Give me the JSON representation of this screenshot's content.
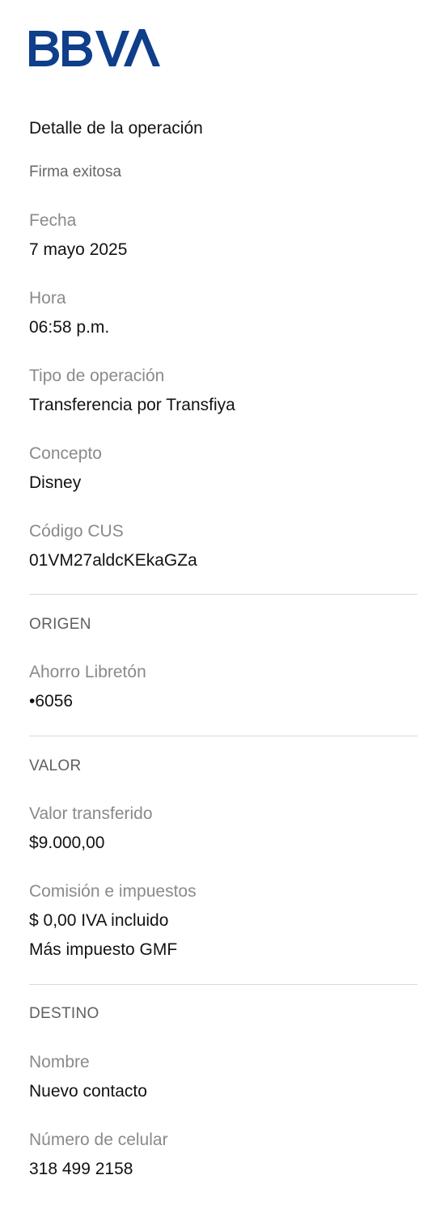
{
  "brand": {
    "name": "BBVA",
    "color": "#0f3e8a"
  },
  "header": {
    "title": "Detalle de la operación",
    "status": "Firma exitosa"
  },
  "details": {
    "fecha_label": "Fecha",
    "fecha_value": "7 mayo 2025",
    "hora_label": "Hora",
    "hora_value": "06:58 p.m.",
    "tipo_label": "Tipo de operación",
    "tipo_value": "Transferencia por Transfiya",
    "concepto_label": "Concepto",
    "concepto_value": "Disney",
    "cus_label": "Código CUS",
    "cus_value": "01VM27aldcKEkaGZa"
  },
  "origen": {
    "heading": "ORIGEN",
    "account_label": "Ahorro Libretón",
    "account_value": "•6056"
  },
  "valor": {
    "heading": "VALOR",
    "transferido_label": "Valor transferido",
    "transferido_value": "$9.000,00",
    "comision_label": "Comisión e impuestos",
    "comision_value": "$ 0,00 IVA incluido",
    "comision_note": "Más impuesto GMF"
  },
  "destino": {
    "heading": "DESTINO",
    "nombre_label": "Nombre",
    "nombre_value": "Nuevo contacto",
    "celular_label": "Número de celular",
    "celular_value": "318 499 2158"
  }
}
